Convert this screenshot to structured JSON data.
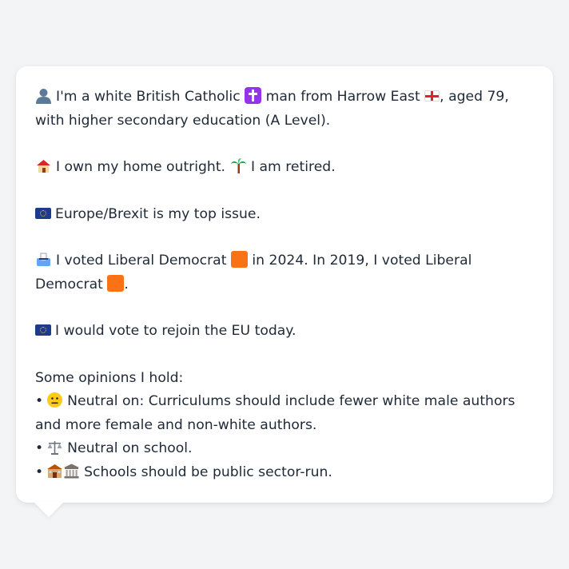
{
  "card": {
    "intro": {
      "icon": "person-silhouette-icon",
      "text_1": "I'm a white British Catholic",
      "icon_cross": "latin-cross-icon",
      "text_2": "man from Harrow East",
      "icon_flag": "england-flag-icon",
      "text_3": ", aged 79, with higher secondary education (A Level)."
    },
    "home": {
      "icon": "house-icon",
      "text_1": "I own my home outright.",
      "icon_2": "palm-tree-icon",
      "text_2": "I am retired."
    },
    "issue": {
      "icon": "eu-flag-icon",
      "text": "Europe/Brexit is my top issue."
    },
    "vote": {
      "icon": "ballot-box-icon",
      "text_1": "I voted Liberal Democrat",
      "party_icon_1": "orange-square-icon",
      "text_2": "in 2024. In 2019, I voted Liberal Democrat",
      "party_icon_2": "orange-square-icon",
      "text_3": "."
    },
    "eu": {
      "icon": "eu-flag-icon",
      "text": "I would vote to rejoin the EU today."
    },
    "opinions": {
      "heading": "Some opinions I hold:",
      "bullet": "•",
      "items": [
        {
          "icons": [
            "neutral-face-icon"
          ],
          "text": "Neutral on: Curriculums should include fewer white male authors and more female and non-white authors."
        },
        {
          "icons": [
            "balance-scale-icon"
          ],
          "text": "Neutral on school."
        },
        {
          "icons": [
            "school-icon",
            "classical-building-icon"
          ],
          "text": "Schools should be public sector-run."
        }
      ]
    }
  },
  "colors": {
    "background": "#f3f4f6",
    "card": "#ffffff",
    "text": "#1f2937",
    "party_orange": "#f97316"
  }
}
